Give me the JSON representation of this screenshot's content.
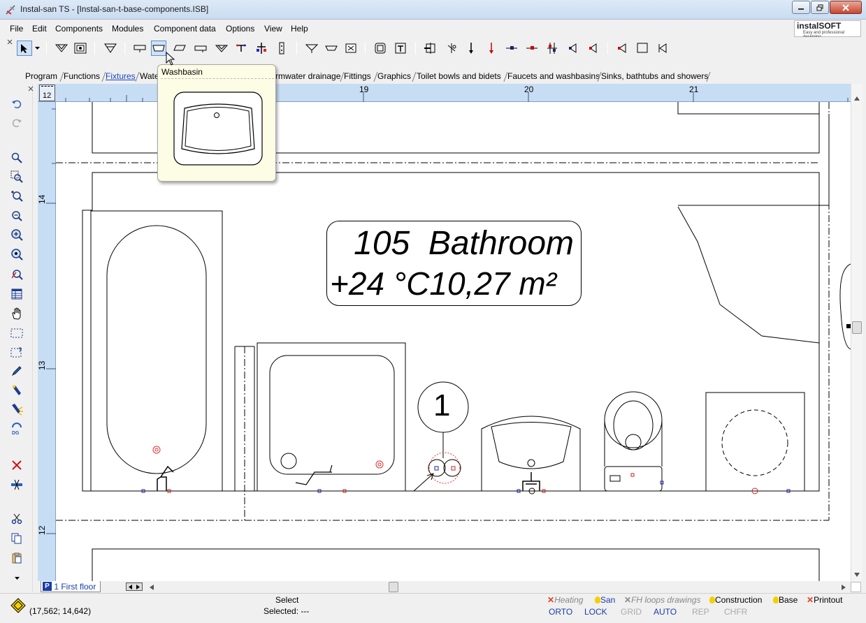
{
  "window": {
    "title": "Instal-san TS - [Instal-san-t-base-components.ISB]"
  },
  "menu": [
    "File",
    "Edit",
    "Components",
    "Modules",
    "Component data",
    "Options",
    "View",
    "Help"
  ],
  "logo": {
    "brand": "instalSOFT",
    "tagline": "Easy and professional designing"
  },
  "tabs": {
    "items": [
      "Program",
      "Functions",
      "Fixtures",
      "Wate",
      "rmwater drainage",
      "Fittings",
      "Graphics",
      "Toilet bowls and bidets",
      "Faucets and washbasins",
      "Sinks, bathtubs and showers"
    ],
    "selected": "Fixtures"
  },
  "tooltip": {
    "title": "Washbasin"
  },
  "ruler": {
    "corner": "12",
    "top": [
      "19",
      "20",
      "21"
    ],
    "left": [
      "14",
      "13",
      "12"
    ]
  },
  "drawing": {
    "room_name": "105  Bathroom",
    "room_info": "+24 °C10,27 m²",
    "marker": "1"
  },
  "page_tab": {
    "icon": "P",
    "label": "1 First floor"
  },
  "status": {
    "coords": "(17,562; 14,642)",
    "action": "Select",
    "selected": "Selected: ---"
  },
  "layer_tabs": [
    {
      "label": "Heating",
      "mark": "x",
      "color": "#e04020"
    },
    {
      "label": "San",
      "mark": "bulb",
      "color": "#f5d000"
    },
    {
      "label": "FH loops drawings",
      "mark": "x",
      "color": "#888888"
    },
    {
      "label": "Construction",
      "mark": "bulb",
      "color": "#f5d000"
    },
    {
      "label": "Base",
      "mark": "bulb",
      "color": "#f5d000"
    },
    {
      "label": "Printout",
      "mark": "x",
      "color": "#e04020"
    }
  ],
  "modes": [
    {
      "label": "ORTO",
      "on": true
    },
    {
      "label": "LOCK",
      "on": true
    },
    {
      "label": "GRID",
      "on": false
    },
    {
      "label": "AUTO",
      "on": true
    },
    {
      "label": "REP",
      "on": false
    },
    {
      "label": "CHFR",
      "on": false
    }
  ],
  "icons": {
    "toolbar": [
      "select-arrow-icon",
      "dropdown-icon",
      "funnel-fixture-icon",
      "image-fixture-icon",
      "drain-funnel-icon",
      "sink-icon",
      "washbasin-icon",
      "urinal-icon",
      "bidet-icon",
      "shower-tray-icon",
      "valve-t-icon",
      "valve-cross-icon",
      "riser-icon",
      "floor-drain-icon",
      "flat-drain-icon",
      "grate-icon",
      "frame-icon",
      "text-frame-icon",
      "pipe-end-icon",
      "branch-icon",
      "down-arrow-icon",
      "down-arrow-red-icon",
      "node-blue-icon",
      "node-red-icon",
      "double-node-icon",
      "left-node-icon",
      "left-node-red-icon",
      "left-tri-icon",
      "rect-icon",
      "left-tri-2-icon"
    ],
    "left": [
      "undo-icon",
      "redo-icon",
      "zoom-icon",
      "zoom-window-icon",
      "zoom-in-icon",
      "zoom-out-icon",
      "zoom-all-icon",
      "zoom-previous-icon",
      "zoom-object-icon",
      "table-icon",
      "pan-hand-icon",
      "select-window-icon",
      "select-query-icon",
      "pencil-icon",
      "flashlight-icon",
      "flashlight-spark-icon",
      "regenerate-icon",
      "delete-icon",
      "cut-pipe-icon",
      "scissors-icon",
      "copy-icon",
      "paste-icon"
    ]
  }
}
